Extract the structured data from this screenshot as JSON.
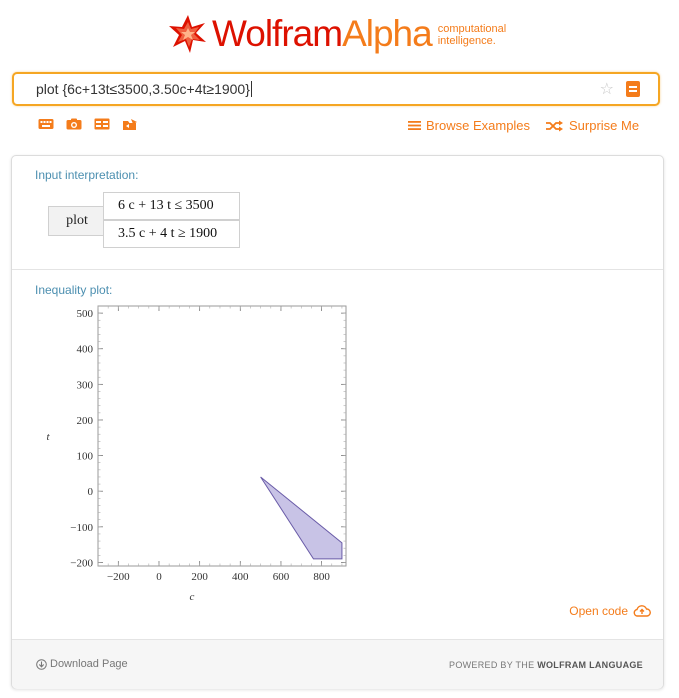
{
  "header": {
    "brand_wolfram": "Wolfram",
    "brand_alpha": "Alpha",
    "tagline_line1": "computational",
    "tagline_line2": "intelligence."
  },
  "search": {
    "query": "plot {6c+13t≤3500,3.50c+4t≥1900}"
  },
  "toolbar": {
    "icons": [
      "keyboard-icon",
      "camera-icon",
      "table-icon",
      "examples-upload-icon"
    ],
    "browse_examples": "Browse Examples",
    "surprise_me": "Surprise Me"
  },
  "input_pod": {
    "title": "Input interpretation:",
    "command": "plot",
    "row1": "6 c + 13 t  ≤  3500",
    "row2": "3.5 c + 4 t  ≥  1900"
  },
  "plot_pod": {
    "title": "Inequality plot:",
    "open_code": "Open code"
  },
  "footer": {
    "download": "Download Page",
    "powered_prefix": "POWERED BY THE ",
    "powered_brand": "WOLFRAM LANGUAGE"
  },
  "colors": {
    "brand_red": "#dd1100",
    "brand_orange": "#f47c1b",
    "pod_title": "#4c8fb0",
    "region_fill": "#c8c3e6",
    "region_stroke": "#6a5ca8"
  },
  "chart_data": {
    "type": "area",
    "title": "",
    "xlabel": "c",
    "ylabel": "t",
    "xlim": [
      -300,
      920
    ],
    "ylim": [
      -210,
      520
    ],
    "xticks": [
      -200,
      0,
      200,
      400,
      600,
      800
    ],
    "yticks": [
      -200,
      -100,
      0,
      100,
      200,
      300,
      400,
      500
    ],
    "xtick_labels": [
      "−200",
      "0",
      "200",
      "400",
      "600",
      "800"
    ],
    "ytick_labels": [
      "−200",
      "−100",
      "0",
      "100",
      "200",
      "300",
      "400",
      "500"
    ],
    "grid": false,
    "series": [
      {
        "points": [
          [
            500,
            40
          ],
          [
            900,
            -145
          ],
          [
            900,
            -190
          ],
          [
            760,
            -190
          ]
        ]
      }
    ]
  }
}
